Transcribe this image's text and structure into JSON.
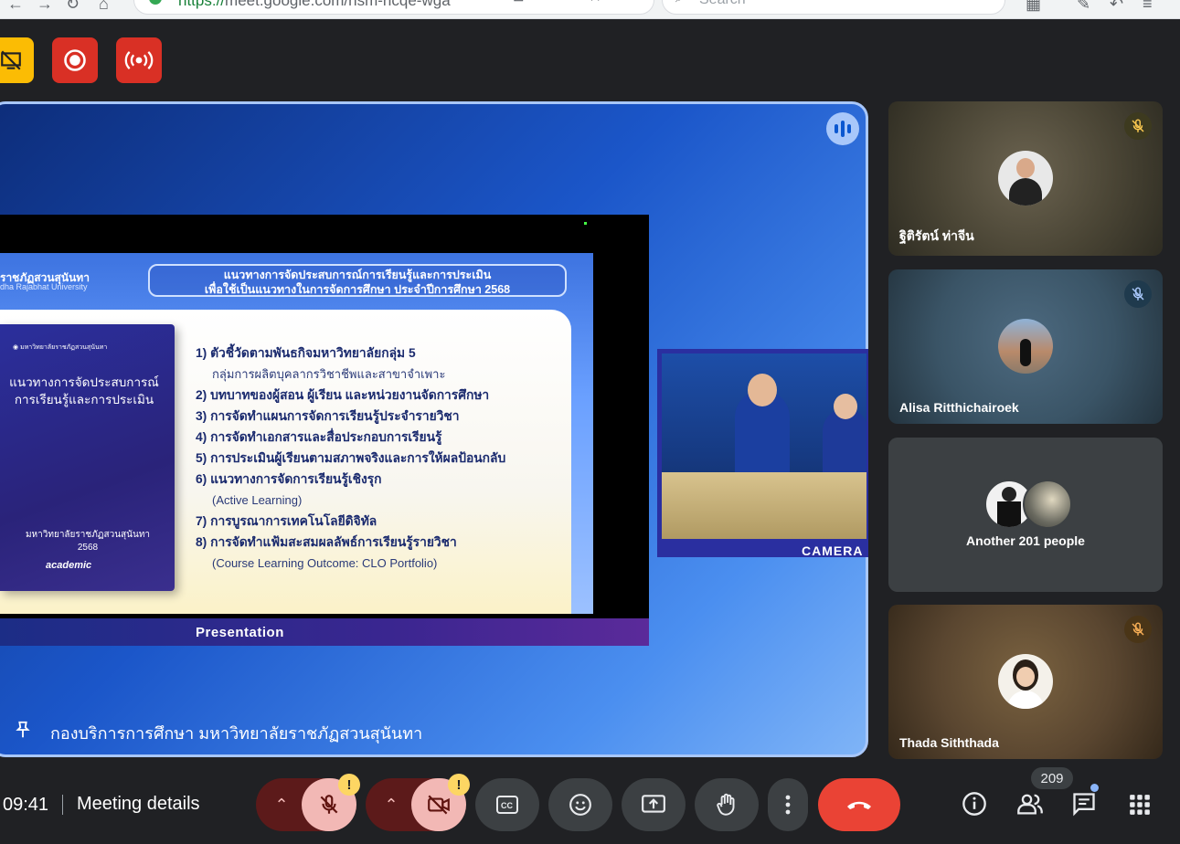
{
  "browser": {
    "url_scheme": "https://",
    "url_rest": "meet.google.com/nsm-ncqe-wga",
    "search_placeholder": "Search"
  },
  "stage": {
    "slide": {
      "university_th": "ราชภัฏสวนสุนันทา",
      "university_en": "dha Rajabhat University",
      "title_line1": "แนวทางการจัดประสบการณ์การเรียนรู้และการประเมิน",
      "title_line2": "เพื่อใช้เป็นแนวทางในการจัดการศึกษา ประจำปีการศึกษา 2568",
      "book": {
        "logo_text": "มหาวิทยาลัยราชภัฏสวนสุนันทา",
        "title_line1": "แนวทางการจัดประสบการณ์",
        "title_line2": "การเรียนรู้และการประเมิน",
        "foot_line1": "มหาวิทยาลัยราชภัฏสวนสุนันทา",
        "foot_line2": "2568",
        "brand": "academic"
      },
      "items": [
        "1) ตัวชี้วัดตามพันธกิจมหาวิทยาลัยกลุ่ม 5",
        "กลุ่มการผลิตบุคลากรวิชาชีพและสาขาจำเพาะ",
        "2) บทบาทของผู้สอน ผู้เรียน และหน่วยงานจัดการศึกษา",
        "3) การจัดทำแผนการจัดการเรียนรู้ประจำรายวิชา",
        "4) การจัดทำเอกสารและสื่อประกอบการเรียนรู้",
        "5) การประเมินผู้เรียนตามสภาพจริงและการให้ผลป้อนกลับ",
        "6) แนวทางการจัดการเรียนรู้เชิงรุก",
        "(Active Learning)",
        "7) การบูรณาการเทคโนโลยีดิจิทัล",
        "8) การจัดทำแฟ้มสะสมผลลัพธ์การเรียนรู้รายวิชา",
        "(Course Learning Outcome: CLO Portfolio)"
      ]
    },
    "presentation_label": "Presentation",
    "camera_label": "CAMERA",
    "presenter_name": "กองบริการการศึกษา มหาวิทยาลัยราชภัฏสวนสุนันทา"
  },
  "participants": [
    {
      "name": "ฐิติรัตน์ ท่าจีน",
      "muted": true,
      "badge_color": "#3d3a1f"
    },
    {
      "name": "Alisa Ritthichairoek",
      "muted": true,
      "badge_color": "#1f3a4d"
    },
    {
      "name": "Another 201 people",
      "muted": false
    },
    {
      "name": "Thada Siththada",
      "muted": true,
      "badge_color": "#4a3517"
    }
  ],
  "bottom_bar": {
    "time": "09:41",
    "meeting_details": "Meeting details",
    "people_count": "209",
    "warning_glyph": "!"
  },
  "colors": {
    "end_call": "#ea4335",
    "mic_off_bg": "#f2b8b5",
    "control_bg": "#3c4043",
    "stage_border": "#a8c7fa",
    "record": "#d93025",
    "no_present": "#fbbc04"
  },
  "icons": [
    "no-present-icon",
    "record-icon",
    "live-stream-icon",
    "speaking-icon",
    "pin-icon",
    "mic-off-icon",
    "camera-off-icon",
    "captions-icon",
    "emoji-icon",
    "present-icon",
    "raise-hand-icon",
    "more-icon",
    "end-call-icon",
    "info-icon",
    "people-icon",
    "chat-icon",
    "activities-icon"
  ]
}
